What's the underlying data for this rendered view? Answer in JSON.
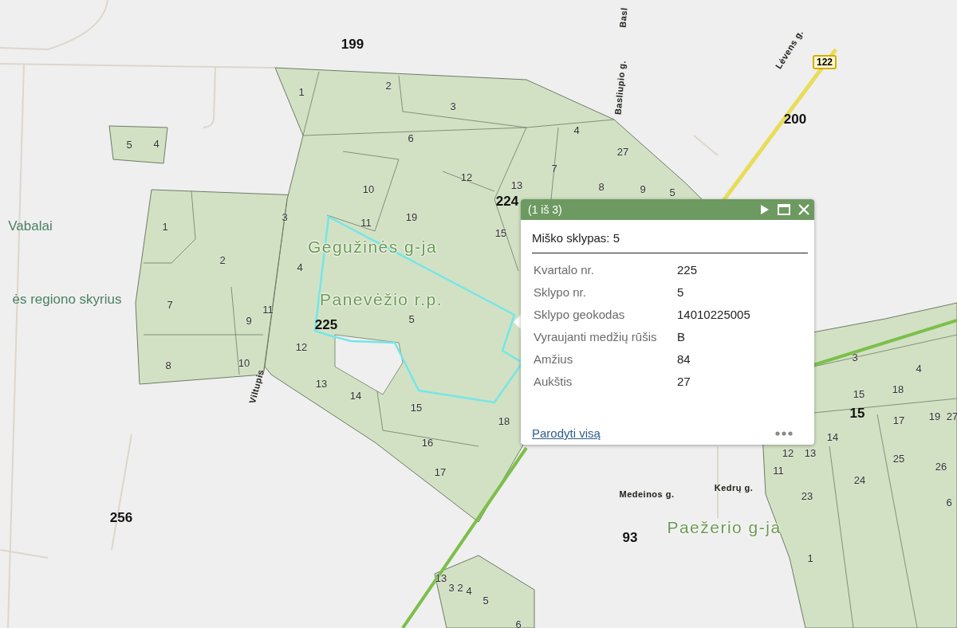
{
  "map": {
    "district_labels": [
      "199",
      "200",
      "224",
      "225",
      "256",
      "93",
      "15"
    ],
    "place_labels": [
      "Vabalai",
      "ės regiono skyrius",
      "Gegužinės g-ja",
      "Panevėžio r.p.",
      "Paežerio g-ja"
    ],
    "street_labels": [
      "Lėvens g.",
      "Basliupio g.",
      "Basl",
      "Viltupis",
      "Medeinos g.",
      "Kedrų g."
    ],
    "route_shield": "122",
    "parcel_labels": [
      "1",
      "2",
      "3",
      "6",
      "10",
      "12",
      "13",
      "11",
      "19",
      "15",
      "4",
      "27",
      "7",
      "8",
      "9",
      "5",
      "4",
      "3",
      "5",
      "12",
      "13",
      "14",
      "15",
      "16",
      "17",
      "18",
      "1",
      "2",
      "7",
      "9",
      "11",
      "8",
      "10",
      "5",
      "4",
      "3",
      "4",
      "15",
      "18",
      "17",
      "19",
      "27",
      "14",
      "12",
      "13",
      "11",
      "25",
      "26",
      "24",
      "23",
      "1",
      "6",
      "13",
      "3",
      "2",
      "4",
      "5",
      "6"
    ]
  },
  "popup": {
    "counter": "(1 iš 3)",
    "title": "Miško sklypas: 5",
    "fields": [
      {
        "label": "Kvartalo nr.",
        "value": "225"
      },
      {
        "label": "Sklypo nr.",
        "value": "5"
      },
      {
        "label": "Sklypo geokodas",
        "value": "14010225005"
      },
      {
        "label": "Vyraujanti medžių rūšis",
        "value": "B"
      },
      {
        "label": "Amžius",
        "value": "84"
      },
      {
        "label": "Aukštis",
        "value": "27"
      }
    ],
    "link": "Parodyti visą"
  }
}
